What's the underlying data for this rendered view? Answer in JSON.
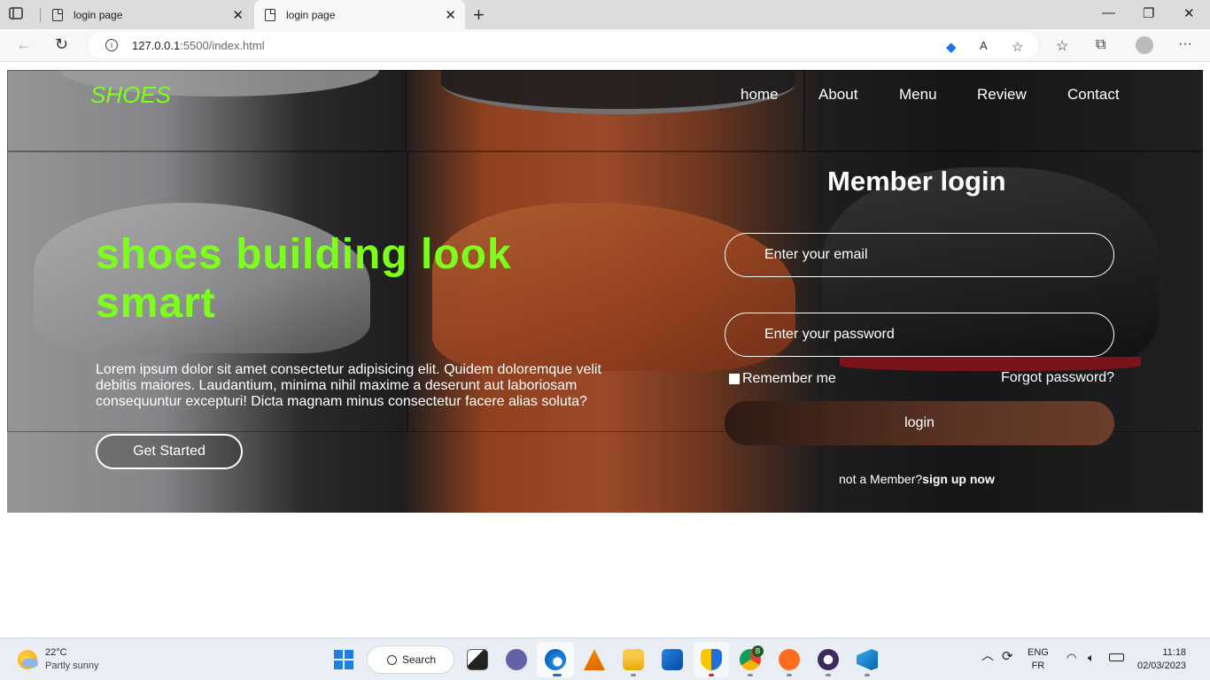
{
  "browser": {
    "tabs": [
      {
        "title": "login page",
        "active": false
      },
      {
        "title": "login page",
        "active": true
      }
    ],
    "url_host": "127.0.0.1",
    "url_rest": ":5500/index.html"
  },
  "site": {
    "logo": "SHOES",
    "nav": [
      "home",
      "About",
      "Menu",
      "Review",
      "Contact"
    ],
    "hero": {
      "title": "shoes building look smart",
      "text": "Lorem ipsum dolor sit amet consectetur adipisicing elit. Quidem doloremque velit debitis maiores. Laudantium, minima nihil maxime a deserunt aut laboriosam consequuntur excepturi! Dicta magnam minus consectetur facere alias soluta?",
      "cta": "Get Started"
    },
    "login": {
      "title": "Member login",
      "email_placeholder": "Enter your email",
      "password_placeholder": "Enter your password",
      "remember": "Remember me",
      "forgot": "Forgot password?",
      "submit": "login",
      "signup_prefix": "not a Member?",
      "signup_link": "sign up now"
    },
    "colors": {
      "accent": "#7cff1a"
    }
  },
  "taskbar": {
    "weather_temp": "22°C",
    "weather_desc": "Partly sunny",
    "search": "Search",
    "lang": "ENG",
    "layout": "FR",
    "time": "11:18",
    "date": "02/03/2023",
    "chrome_badge": "B"
  }
}
